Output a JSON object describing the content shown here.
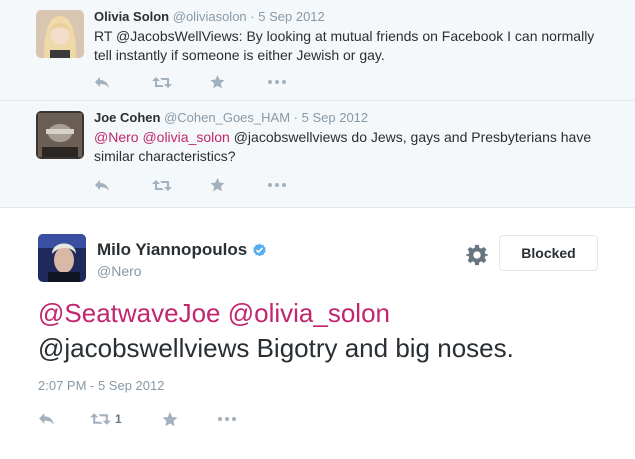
{
  "tweets": [
    {
      "fullname": "Olivia Solon",
      "username": "@oliviasolon",
      "separator": "·",
      "time": "5 Sep 2012",
      "text_parts": [
        {
          "text": "RT @JacobsWellViews: By looking at mutual friends on Facebook I can normally tell instantly if someone is either Jewish or gay.",
          "mention": false
        }
      ]
    },
    {
      "fullname": "Joe Cohen",
      "username": "@Cohen_Goes_HAM",
      "separator": "·",
      "time": "5 Sep 2012",
      "text_parts": [
        {
          "text": "@Nero",
          "mention": true
        },
        {
          "text": " ",
          "mention": false
        },
        {
          "text": "@olivia_solon",
          "mention": true
        },
        {
          "text": " @jacobswellviews do Jews, gays and Presbyterians have similar characteristics?",
          "mention": false
        }
      ]
    }
  ],
  "main": {
    "fullname": "Milo Yiannopoulos",
    "username": "@Nero",
    "verified_icon": "verified-badge-icon",
    "blocked_label": "Blocked",
    "mention1": "@SeatwaveJoe",
    "mention2": "@olivia_solon",
    "text_rest": "@jacobswellviews Bigotry and big noses.",
    "timestamp": "2:07 PM - 5 Sep 2012",
    "retweet_count": "1"
  },
  "icons": [
    "reply-icon",
    "retweet-icon",
    "favorite-icon",
    "more-icon",
    "gear-icon",
    "verified-badge-icon"
  ],
  "colors": {
    "mention": "#c1266f",
    "verified": "#55acee",
    "secondary_text": "#8899a6",
    "reply_bg": "#f5f8fa",
    "action_icon": "#a2b1bd"
  }
}
